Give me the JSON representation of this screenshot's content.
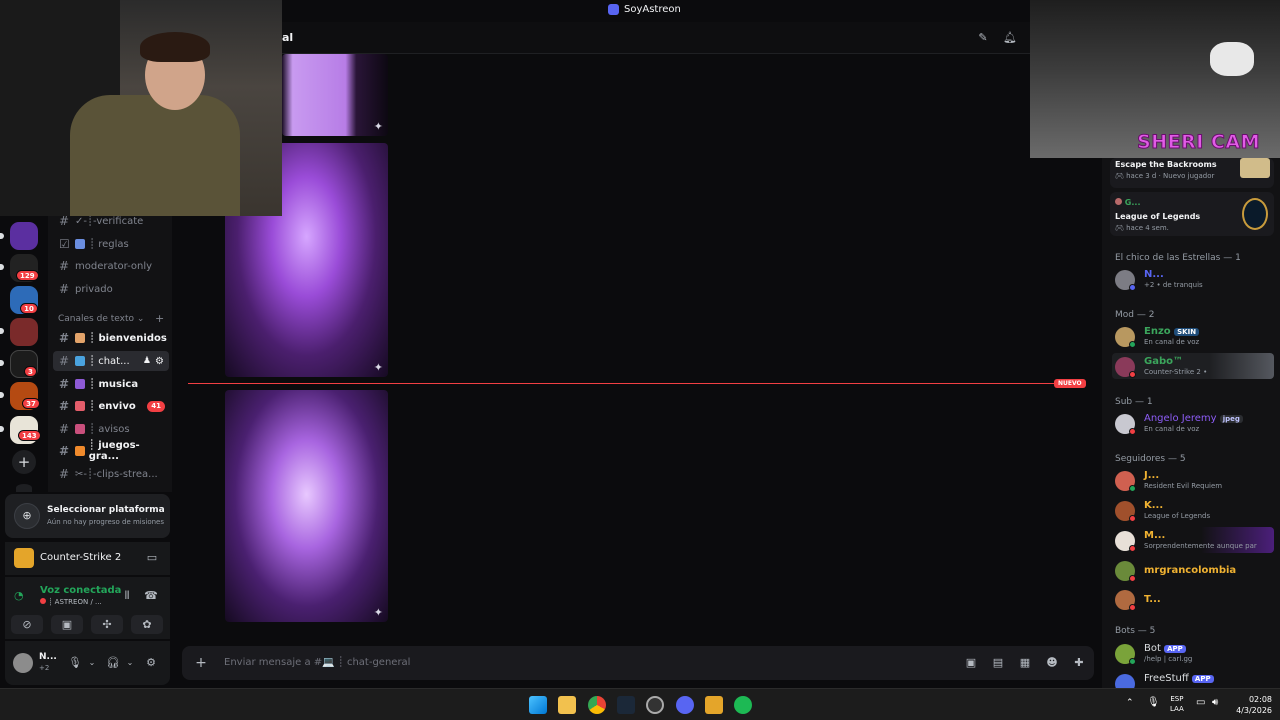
{
  "window": {
    "title": "SoyAstreon"
  },
  "header": {
    "channel_partial": "al"
  },
  "rail": {
    "badges": [
      "129",
      "10",
      "3",
      "37",
      "143"
    ]
  },
  "channels": {
    "items": [
      {
        "label": "✓-┊-verificate",
        "state": "muted"
      },
      {
        "label": "┊ reglas",
        "state": "muted"
      },
      {
        "label": "moderator-only",
        "state": "muted"
      },
      {
        "label": "privado",
        "state": "muted"
      }
    ],
    "category": "Canales de texto",
    "text_channels": [
      {
        "label": "┊ bienvenidos",
        "state": "unread"
      },
      {
        "label": "┊ chat...",
        "state": "active"
      },
      {
        "label": "┊ musica",
        "state": "unread"
      },
      {
        "label": "┊ envivo",
        "state": "unread",
        "badge": "41"
      },
      {
        "label": "┊ avisos",
        "state": "muted"
      },
      {
        "label": "┊ juegos-gra...",
        "state": "unread"
      },
      {
        "label": "✂-┊-clips-strea...",
        "state": "muted"
      }
    ]
  },
  "quest": {
    "title": "Seleccionar plataforma",
    "subtitle": "Aún no hay progreso de misiones"
  },
  "activity": {
    "game": "Counter-Strike 2"
  },
  "voice": {
    "status": "Voz conectada",
    "channel": "┊ ASTREON / ..."
  },
  "user": {
    "name": "N...",
    "sub": "+2"
  },
  "chat": {
    "new_label": "NUEVO",
    "composer_placeholder": "Enviar mensaje a #💻 ┊ chat-general"
  },
  "members": {
    "top_cards": [
      {
        "title": "Escape the Backrooms",
        "meta1": "hace 3 d",
        "meta2": "Nuevo jugador"
      },
      {
        "user": "G...",
        "title": "League of Legends",
        "meta1": "hace 4 sem."
      }
    ],
    "sections": [
      {
        "label": "El chico de las Estrellas — 1"
      },
      {
        "label": "Mod — 2"
      },
      {
        "label": "Sub — 1"
      },
      {
        "label": "Seguidores — 5"
      },
      {
        "label": "Bots — 5"
      }
    ],
    "list": [
      {
        "name": "N...",
        "sub": "+2 • de tranquis",
        "color": "#5865f2"
      },
      {
        "name": "Enzo",
        "tag": "SKIN",
        "sub": "En canal de voz",
        "color": "#3ba55c"
      },
      {
        "name": "Gabo™",
        "sub": "Counter-Strike 2 •",
        "color": "#3ba55c"
      },
      {
        "name": "Angelo Jeremy",
        "tag": "jpeg",
        "sub": "En canal de voz",
        "color": "#8d5cf6"
      },
      {
        "name": "J...",
        "sub": "Resident Evil Requiem",
        "color": "#f0b232"
      },
      {
        "name": "K...",
        "sub": "League of Legends",
        "color": "#f0b232"
      },
      {
        "name": "M...",
        "sub": "Sorprendentemente aunque par",
        "color": "#f0b232"
      },
      {
        "name": "mrgrancolombia",
        "sub": "",
        "color": "#f0b232"
      },
      {
        "name": "T...",
        "sub": "",
        "color": "#f0b232"
      },
      {
        "name": "Bot",
        "tag": "APP",
        "sub": "/help | carl.gg",
        "color": "#dbdee1"
      },
      {
        "name": "FreeStuff",
        "tag": "APP",
        "sub": "",
        "color": "#dbdee1"
      }
    ]
  },
  "cam": {
    "label": "SHERI CAM"
  },
  "taskbar": {
    "lang1": "ESP",
    "lang2": "LAA",
    "time": "02:08",
    "date": "4/3/2026"
  }
}
